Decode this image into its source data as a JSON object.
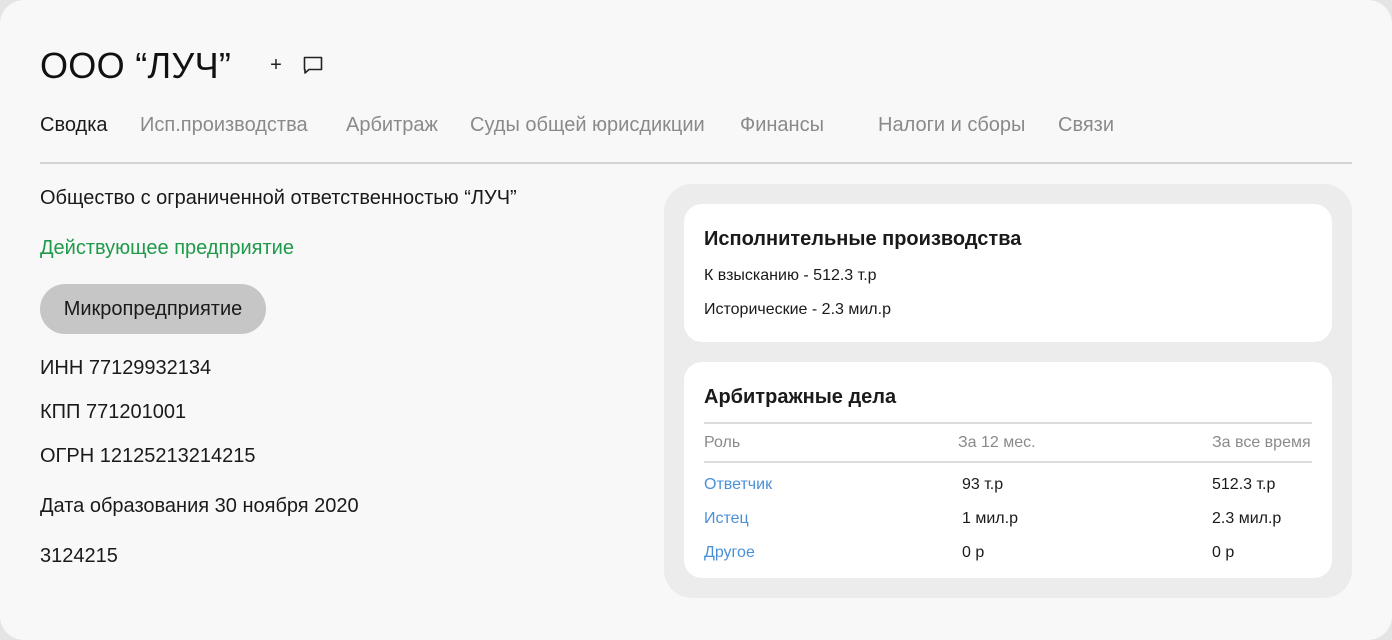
{
  "header": {
    "title": "ООО “ЛУЧ”",
    "add_icon": "plus-icon",
    "comment_icon": "chat-icon"
  },
  "tabs": [
    {
      "label": "Сводка",
      "active": true
    },
    {
      "label": "Исп.производства",
      "active": false
    },
    {
      "label": "Арбитраж",
      "active": false
    },
    {
      "label": "Суды общей юрисдикции",
      "active": false
    },
    {
      "label": "Финансы",
      "active": false
    },
    {
      "label": "Налоги и сборы",
      "active": false
    },
    {
      "label": "Связи",
      "active": false
    }
  ],
  "summary": {
    "full_name": "Общество с ограниченной ответственностью “ЛУЧ”",
    "status": "Действующее предприятие",
    "category": "Микропредприятие",
    "inn": "ИНН 77129932134",
    "kpp": "КПП 771201001",
    "ogrn": "ОГРН 12125213214215",
    "founded": "Дата образования 30 ноября 2020",
    "extra_number": "3124215"
  },
  "enforcement": {
    "title": "Исполнительные производства",
    "to_collect": "К взысканию - 512.3 т.р",
    "historical": "Исторические - 2.3 мил.р"
  },
  "arbitration": {
    "title": "Арбитражные дела",
    "columns": [
      "Роль",
      "За 12 мес.",
      "За все время"
    ],
    "rows": [
      [
        "Ответчик",
        "93 т.р",
        "512.3 т.р"
      ],
      [
        "Истец",
        "1 мил.р",
        "2.3 мил.р"
      ],
      [
        "Другое",
        "0 р",
        "0 р"
      ]
    ]
  },
  "colors": {
    "status_green": "#1f9a4a",
    "link_blue": "#4a90d9",
    "pill_bg": "#c6c6c6",
    "panel_bg": "#ececec"
  }
}
